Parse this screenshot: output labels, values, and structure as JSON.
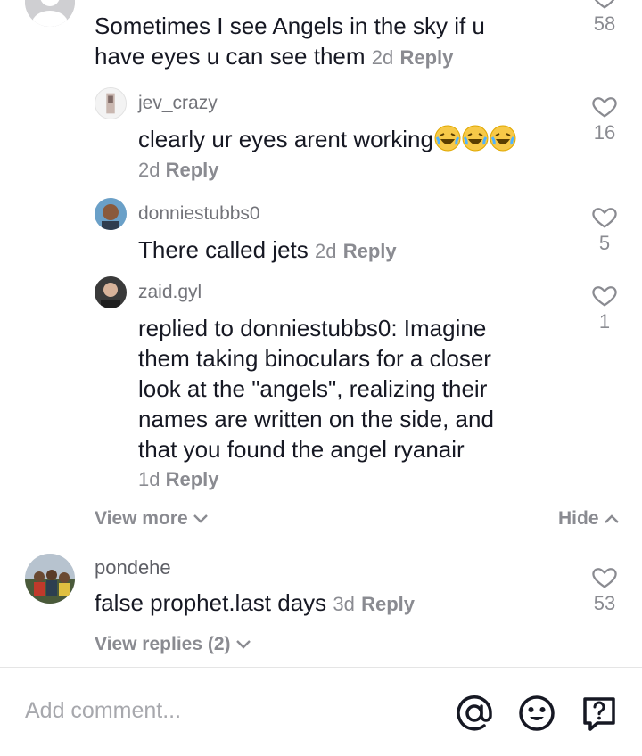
{
  "comments": [
    {
      "text": "Sometimes I see Angels in the sky if u",
      "text2": "have eyes u can see them",
      "time": "2d",
      "reply": "Reply",
      "likes": "58"
    },
    {
      "username": "jev_crazy",
      "text": "clearly ur eyes arent working",
      "time": "2d",
      "reply": "Reply",
      "likes": "16"
    },
    {
      "username": "donniestubbs0",
      "text": "There called jets",
      "time": "2d",
      "reply": "Reply",
      "likes": "5"
    },
    {
      "username": "zaid.gyl",
      "replied_prefix": "replied to",
      "replied_user": "donniestubbs0",
      "lines": [
        ": Imagine",
        "them taking binoculars for a closer",
        "look at the \"angels\", realizing their",
        "names are written on the side, and",
        "that you found the angel ryanair"
      ],
      "time": "1d",
      "reply": "Reply",
      "likes": "1"
    },
    {
      "username": "pondehe",
      "text": "false prophet.last days",
      "time": "3d",
      "reply": "Reply",
      "likes": "53"
    }
  ],
  "view_more": "View more",
  "hide": "Hide",
  "view_replies": "View replies (2)",
  "composer": {
    "placeholder": "Add comment..."
  },
  "colors": {
    "text": "#161823",
    "muted": "#8a8b91",
    "divider": "#e5e5e5"
  }
}
